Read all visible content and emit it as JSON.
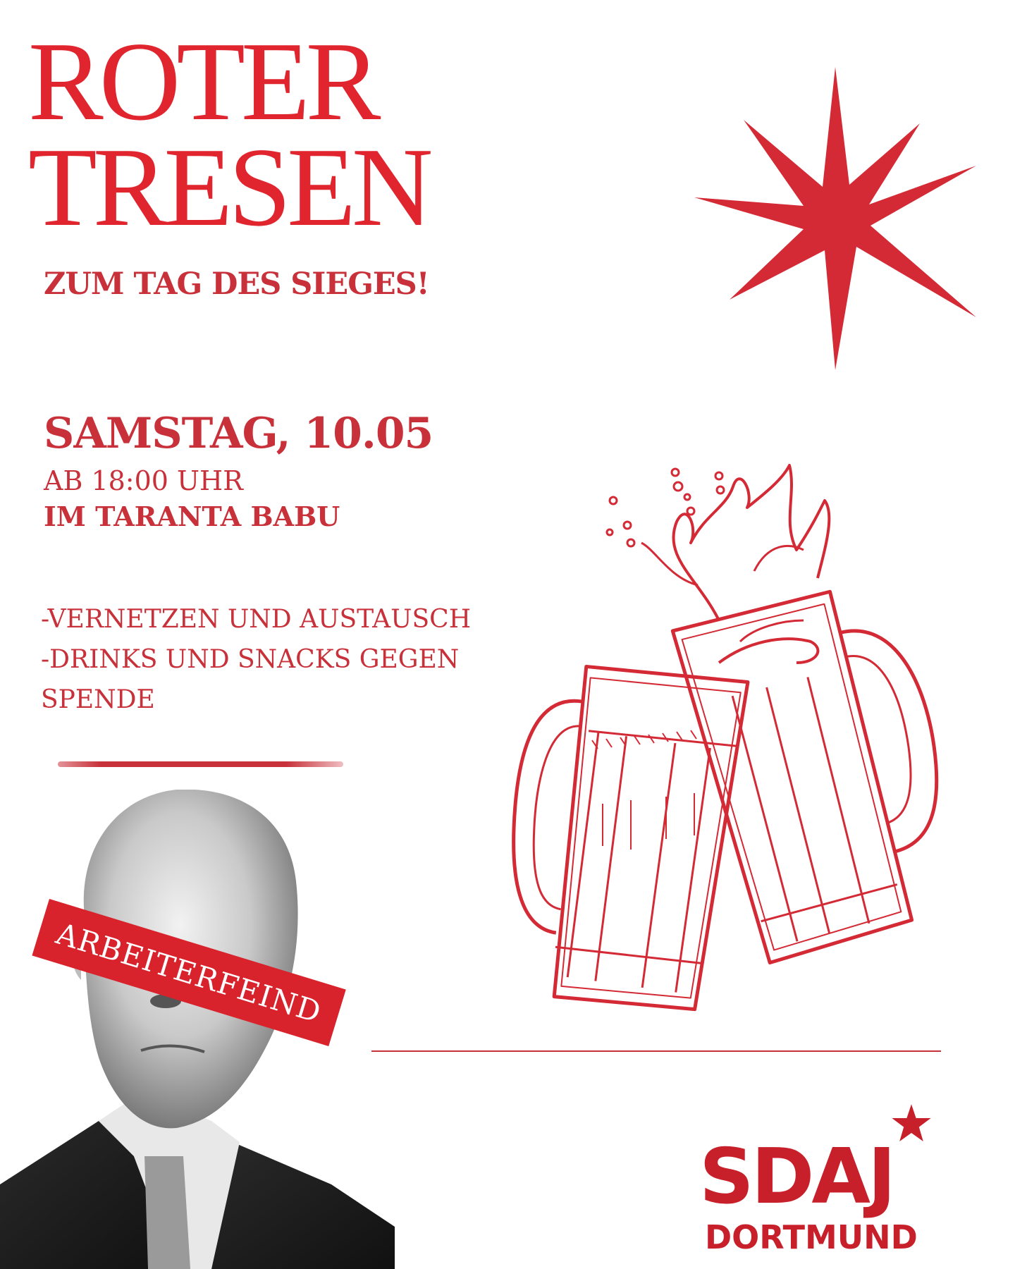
{
  "title": {
    "line1": "ROTER",
    "line2": "TRESEN"
  },
  "subtitle": "ZUM TAG DES SIEGES!",
  "event": {
    "date": "SAMSTAG, 10.05",
    "time": "AB 18:00 UHR",
    "place": "IM TARANTA BABU"
  },
  "features": [
    "-VERNETZEN UND AUSTAUSCH",
    "-DRINKS UND SNACKS GEGEN",
    "SPENDE"
  ],
  "portrait_tag": "ARBEITERFEIND",
  "logo": {
    "name": "SDAJ",
    "city": "DORTMUND"
  },
  "colors": {
    "primary": "#c8313a",
    "title": "#e0252f",
    "tag": "#d8232c",
    "background": "#ffffff"
  },
  "icons": [
    "eight-point-star-icon",
    "beer-mugs-illustration",
    "logo-star-icon"
  ]
}
